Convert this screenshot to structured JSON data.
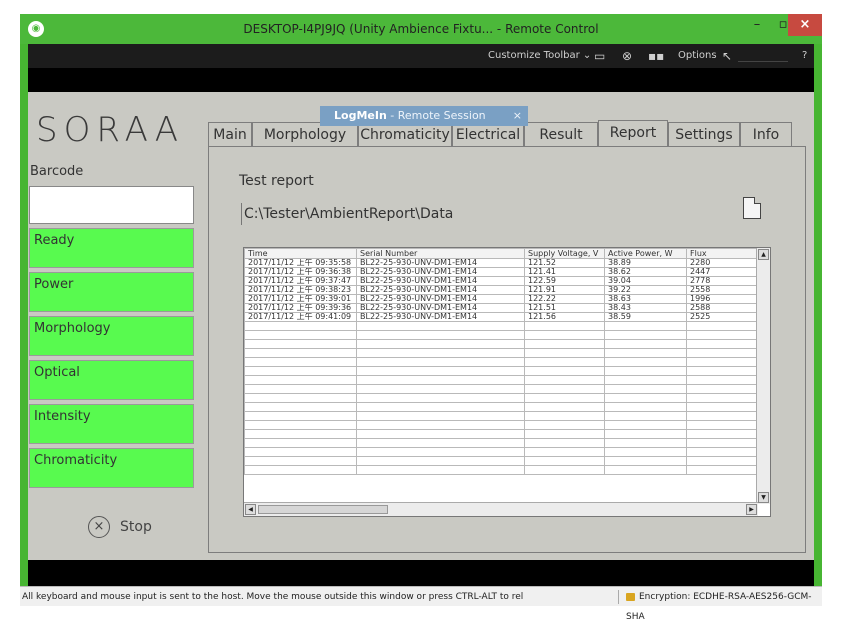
{
  "window": {
    "title": "DESKTOP-I4PJ9JQ (Unity Ambience Fixtu... - Remote Control"
  },
  "remote_toolbar": {
    "customize_label": "Customize Toolbar",
    "options_label": "Options",
    "help_label": "?"
  },
  "logmein": {
    "brand": "LogMeIn",
    "session": " - Remote Session",
    "close": "×"
  },
  "app": {
    "logo": "SORAA",
    "barcode_label": "Barcode",
    "barcode_value": "",
    "status_items": [
      "Ready",
      "Power",
      "Morphology",
      "Optical",
      "Intensity",
      "Chromaticity"
    ],
    "status_color": "#58fa4f",
    "stop_label": "Stop",
    "tabs": [
      "Main",
      "Morphology",
      "Chromaticity",
      "Electrical",
      "Result",
      "Report",
      "Settings",
      "Info"
    ],
    "active_tab": "Report",
    "report": {
      "heading": "Test report",
      "path": "C:\\Tester\\AmbientReport\\Data",
      "columns": [
        "Time",
        "Serial Number",
        "Supply Voltage, V",
        "Active Power, W",
        "Flux"
      ],
      "rows": [
        [
          "2017/11/12 上午 09:35:58",
          "BL22-25-930-UNV-DM1-EM14",
          "121.52",
          "38.89",
          "2280"
        ],
        [
          "2017/11/12 上午 09:36:38",
          "BL22-25-930-UNV-DM1-EM14",
          "121.41",
          "38.62",
          "2447"
        ],
        [
          "2017/11/12 上午 09:37:47",
          "BL22-25-930-UNV-DM1-EM14",
          "122.59",
          "39.04",
          "2778"
        ],
        [
          "2017/11/12 上午 09:38:23",
          "BL22-25-930-UNV-DM1-EM14",
          "121.91",
          "39.22",
          "2558"
        ],
        [
          "2017/11/12 上午 09:39:01",
          "BL22-25-930-UNV-DM1-EM14",
          "122.22",
          "38.63",
          "1996"
        ],
        [
          "2017/11/12 上午 09:39:36",
          "BL22-25-930-UNV-DM1-EM14",
          "121.51",
          "38.43",
          "2588"
        ],
        [
          "2017/11/12 上午 09:41:09",
          "BL22-25-930-UNV-DM1-EM14",
          "121.56",
          "38.59",
          "2525"
        ]
      ]
    }
  },
  "statusbar": {
    "message": "All keyboard and mouse input is sent to the host. Move the mouse outside this window or press CTRL-ALT to rel",
    "encryption": "Encryption: ECDHE-RSA-AES256-GCM-SHA"
  }
}
